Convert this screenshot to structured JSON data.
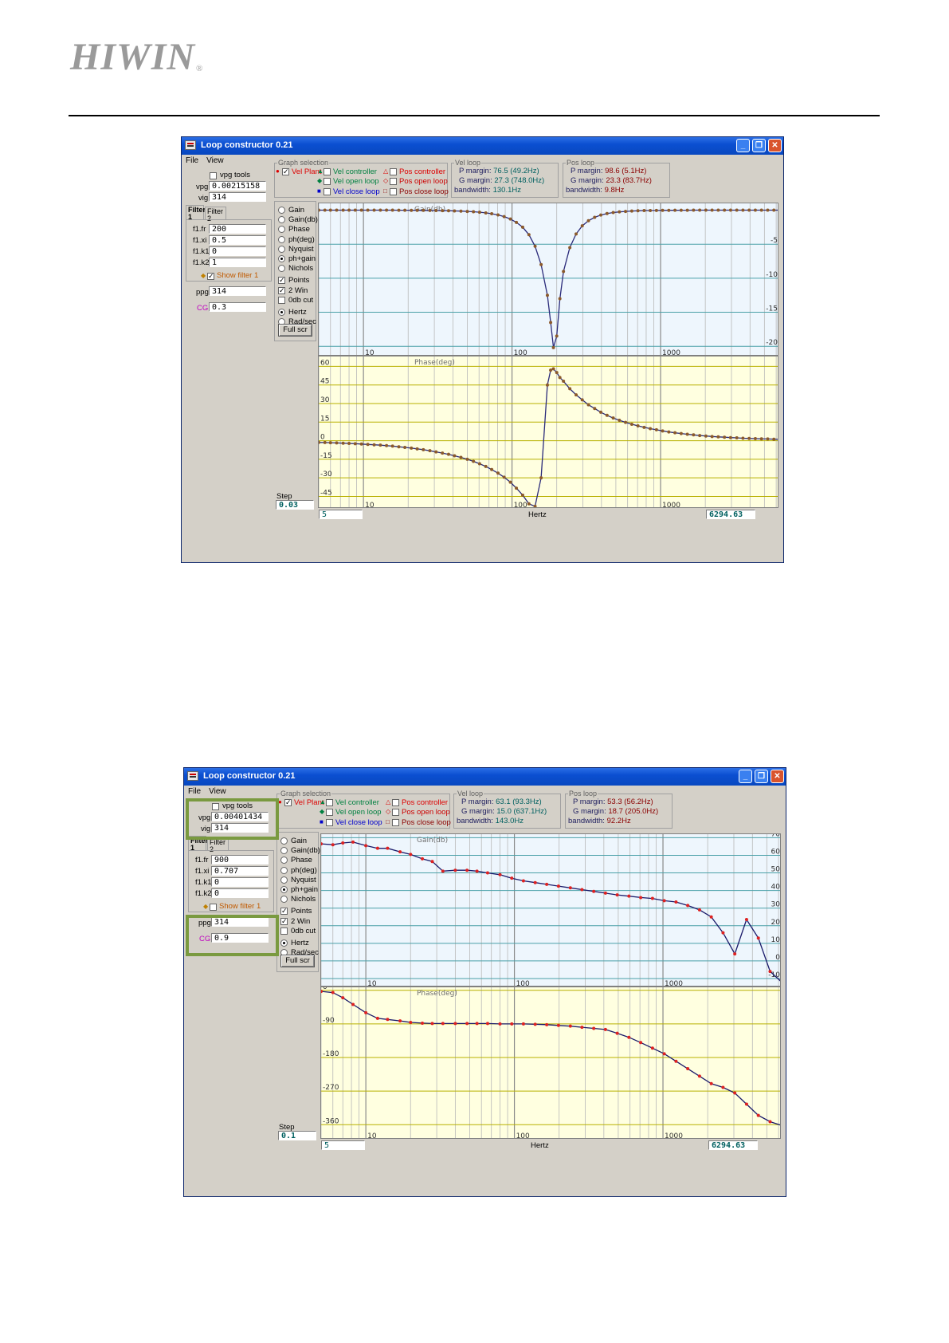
{
  "logo": {
    "text": "HIWIN",
    "reg": "®"
  },
  "windows": [
    {
      "title": "Loop constructor 0.21",
      "menu": [
        "File",
        "View"
      ],
      "vpg_tools_label": "vpg tools",
      "vpg_label": "vpg",
      "vpg_value": "0.00215158",
      "vig_label": "vig",
      "vig_value": "314",
      "tabs": [
        {
          "line1": "Filter",
          "line2": "1"
        },
        {
          "line1": "Filter",
          "line2": "2"
        }
      ],
      "filter": [
        {
          "label": "f1.fr",
          "value": "200"
        },
        {
          "label": "f1.xi",
          "value": "0.5"
        },
        {
          "label": "f1.k1",
          "value": "0"
        },
        {
          "label": "f1.k2",
          "value": "1"
        }
      ],
      "show_filter_label": "Show filter 1",
      "show_filter_checked": true,
      "ppg_label": "ppg",
      "ppg_value": "314",
      "cg_label": "CG",
      "cg_value": "0.3",
      "graph_selection_title": "Graph selection",
      "graph_items": [
        {
          "label": "Vel Plant",
          "checked": true,
          "color": "#dd0000",
          "marker": "●"
        },
        {
          "label": "Vel controller",
          "checked": false,
          "color": "#008040",
          "marker": "▲"
        },
        {
          "label": "Vel open loop",
          "checked": false,
          "color": "#008040",
          "marker": "◆"
        },
        {
          "label": "Vel close loop",
          "checked": false,
          "color": "#0000cc",
          "marker": "■"
        },
        {
          "label": "Pos controller",
          "checked": false,
          "color": "#dd0000",
          "marker": "△"
        },
        {
          "label": "Pos open loop",
          "checked": false,
          "color": "#cc0000",
          "marker": "◇"
        },
        {
          "label": "Pos close loop",
          "checked": false,
          "color": "#8b0000",
          "marker": "□"
        }
      ],
      "vel_loop": {
        "title": "Vel loop",
        "p_margin": "76.5 (49.2Hz)",
        "g_margin": "27.3 (748.0Hz)",
        "bandwidth": "130.1Hz"
      },
      "pos_loop": {
        "title": "Pos loop",
        "p_margin": "98.6 (5.1Hz)",
        "g_margin": "23.3 (83.7Hz)",
        "bandwidth": "9.8Hz"
      },
      "margin_labels": {
        "p": "P margin:",
        "g": "G margin:",
        "bw": "bandwidth:"
      },
      "options": [
        {
          "label": "Gain",
          "type": "radio",
          "on": false
        },
        {
          "label": "Gain(db)",
          "type": "radio",
          "on": false
        },
        {
          "label": "Phase",
          "type": "radio",
          "on": false
        },
        {
          "label": "ph(deg)",
          "type": "radio",
          "on": false
        },
        {
          "label": "Nyquist",
          "type": "radio",
          "on": false
        },
        {
          "label": "ph+gain",
          "type": "radio",
          "on": true
        },
        {
          "label": "Nichols",
          "type": "radio",
          "on": false
        },
        {
          "label": "Points",
          "type": "check",
          "on": true
        },
        {
          "label": "2 Win",
          "type": "check",
          "on": true
        },
        {
          "label": "0db cut",
          "type": "check",
          "on": false
        },
        {
          "label": "Hertz",
          "type": "radio",
          "on": true
        },
        {
          "label": "Rad/sec",
          "type": "radio",
          "on": false
        }
      ],
      "full_scr": "Full scr",
      "step_label": "Step",
      "step_value": "0.03",
      "xmin_value": "5",
      "xaxis_label": "Hertz",
      "xmax_value": "6294.63",
      "highlight": false,
      "chart_data": [
        {
          "type": "line",
          "title": "Gain(db)",
          "x_scale": "log",
          "xlim": [
            5,
            6294.63
          ],
          "x_ticks": [
            10,
            100,
            1000
          ],
          "ylim": [
            -21.5,
            1
          ],
          "y_ticks": [
            -5,
            -10,
            -15,
            -20
          ],
          "y_tick_labels": [
            "-5",
            "-10",
            "-15",
            "-20"
          ],
          "y_ticks_side": "right",
          "line_color": "#2a2a7a",
          "point_color": "#8b5a2b",
          "background": "#eef6fd",
          "grid": true,
          "x": [
            5,
            5.5,
            6,
            6.6,
            7.3,
            8,
            8.8,
            9.7,
            10.7,
            11.8,
            13,
            14.3,
            15.7,
            17.3,
            19,
            21,
            23,
            25.3,
            28,
            30.8,
            34,
            37.4,
            41,
            45.3,
            50,
            55,
            60.5,
            66.6,
            73,
            80.5,
            88.5,
            97.5,
            107,
            118,
            130,
            143,
            157,
            173,
            182,
            190,
            200,
            210,
            222,
            245,
            270,
            297,
            327,
            360,
            396,
            436,
            480,
            528,
            581,
            640,
            704,
            775,
            852,
            938,
            1032,
            1136,
            1250,
            1376,
            1514,
            1666,
            1834,
            2018,
            2221,
            2444,
            2690,
            2960,
            3258,
            3585,
            3946,
            4342,
            4779,
            5259,
            5788,
            6294
          ],
          "values": [
            0,
            0,
            0,
            0,
            0,
            0,
            0,
            0,
            0,
            0,
            0,
            0,
            0,
            -0.01,
            -0.01,
            -0.02,
            -0.02,
            -0.03,
            -0.04,
            -0.05,
            -0.07,
            -0.08,
            -0.11,
            -0.14,
            -0.18,
            -0.23,
            -0.3,
            -0.4,
            -0.52,
            -0.7,
            -0.95,
            -1.3,
            -1.8,
            -2.5,
            -3.6,
            -5.3,
            -8.0,
            -12.5,
            -16.5,
            -20.2,
            -18.5,
            -13,
            -9,
            -5.5,
            -3.5,
            -2.3,
            -1.55,
            -1.05,
            -0.72,
            -0.5,
            -0.35,
            -0.25,
            -0.18,
            -0.13,
            -0.09,
            -0.06,
            -0.05,
            -0.04,
            -0.03,
            -0.02,
            -0.015,
            -0.01,
            -0.01,
            0,
            0,
            0,
            0,
            0,
            0,
            0,
            0,
            0,
            0,
            0,
            0,
            0,
            0,
            0
          ]
        },
        {
          "type": "line",
          "title": "Phase(deg)",
          "x_scale": "log",
          "xlim": [
            5,
            6294.63
          ],
          "x_ticks": [
            10,
            100,
            1000
          ],
          "ylim": [
            -55,
            68
          ],
          "y_ticks": [
            60,
            45,
            30,
            15,
            0,
            -15,
            -30,
            -45
          ],
          "y_tick_labels": [
            "60",
            "45",
            "30",
            "15",
            "0",
            "-15",
            "-30",
            "-45"
          ],
          "y_ticks_side": "left",
          "line_color": "#2a2a7a",
          "point_color": "#8b5a2b",
          "background": "#ffffe0",
          "grid": true,
          "x": [
            5,
            5.5,
            6,
            6.6,
            7.3,
            8,
            8.8,
            9.7,
            10.7,
            11.8,
            13,
            14.3,
            15.7,
            17.3,
            19,
            21,
            23,
            25.3,
            28,
            30.8,
            34,
            37.4,
            41,
            45.3,
            50,
            55,
            60.5,
            66.6,
            73,
            80.5,
            88.5,
            97.5,
            107,
            118,
            130,
            143,
            157,
            173,
            182,
            190,
            200,
            210,
            222,
            245,
            270,
            297,
            327,
            360,
            396,
            436,
            480,
            528,
            581,
            640,
            704,
            775,
            852,
            938,
            1032,
            1136,
            1250,
            1376,
            1514,
            1666,
            1834,
            2018,
            2221,
            2444,
            2690,
            2960,
            3258,
            3585,
            3946,
            4342,
            4779,
            5259,
            5788,
            6294
          ],
          "values": [
            -1.4,
            -1.5,
            -1.6,
            -1.8,
            -2.0,
            -2.2,
            -2.4,
            -2.7,
            -3.0,
            -3.3,
            -3.6,
            -4.0,
            -4.4,
            -4.9,
            -5.4,
            -6.0,
            -6.6,
            -7.3,
            -8.1,
            -9.0,
            -10.0,
            -11.0,
            -12.2,
            -13.5,
            -15.0,
            -16.7,
            -18.6,
            -20.8,
            -23.3,
            -26.2,
            -29.5,
            -33.5,
            -38.3,
            -44.0,
            -51.0,
            -53.0,
            -30.0,
            45.0,
            57.0,
            58.0,
            55.0,
            51.0,
            48.0,
            42.0,
            37.0,
            33.0,
            29.0,
            26.0,
            23.0,
            20.5,
            18.3,
            16.5,
            14.8,
            13.3,
            12.0,
            10.8,
            9.7,
            8.8,
            7.9,
            7.1,
            6.4,
            5.8,
            5.2,
            4.7,
            4.2,
            3.8,
            3.4,
            3.1,
            2.8,
            2.5,
            2.3,
            2.0,
            1.8,
            1.7,
            1.5,
            1.4,
            1.2,
            1.1
          ]
        }
      ]
    },
    {
      "title": "Loop constructor 0.21",
      "menu": [
        "File",
        "View"
      ],
      "vpg_tools_label": "vpg tools",
      "vpg_label": "vpg",
      "vpg_value": "0.00401434",
      "vig_label": "vig",
      "vig_value": "314",
      "tabs": [
        {
          "line1": "Filter",
          "line2": "1"
        },
        {
          "line1": "Filter",
          "line2": "2"
        }
      ],
      "filter": [
        {
          "label": "f1.fr",
          "value": "900"
        },
        {
          "label": "f1.xi",
          "value": "0.707"
        },
        {
          "label": "f1.k1",
          "value": "0"
        },
        {
          "label": "f1.k2",
          "value": "0"
        }
      ],
      "show_filter_label": "Show filter 1",
      "show_filter_checked": false,
      "ppg_label": "ppg",
      "ppg_value": "314",
      "cg_label": "CG",
      "cg_value": "0.9",
      "graph_selection_title": "Graph selection",
      "graph_items": [
        {
          "label": "Vel Plant",
          "checked": true,
          "color": "#dd0000",
          "marker": "●"
        },
        {
          "label": "Vel controller",
          "checked": false,
          "color": "#008040",
          "marker": "▲"
        },
        {
          "label": "Vel open loop",
          "checked": false,
          "color": "#008040",
          "marker": "◆"
        },
        {
          "label": "Vel close loop",
          "checked": false,
          "color": "#0000cc",
          "marker": "■"
        },
        {
          "label": "Pos controller",
          "checked": false,
          "color": "#dd0000",
          "marker": "△"
        },
        {
          "label": "Pos open loop",
          "checked": false,
          "color": "#cc0000",
          "marker": "◇"
        },
        {
          "label": "Pos close loop",
          "checked": false,
          "color": "#8b0000",
          "marker": "□"
        }
      ],
      "vel_loop": {
        "title": "Vel loop",
        "p_margin": "63.1 (93.3Hz)",
        "g_margin": "15.0 (637.1Hz)",
        "bandwidth": "143.0Hz"
      },
      "pos_loop": {
        "title": "Pos loop",
        "p_margin": "53.3 (56.2Hz)",
        "g_margin": "18.7 (205.0Hz)",
        "bandwidth": "92.2Hz"
      },
      "margin_labels": {
        "p": "P margin:",
        "g": "G margin:",
        "bw": "bandwidth:"
      },
      "options": [
        {
          "label": "Gain",
          "type": "radio",
          "on": false
        },
        {
          "label": "Gain(db)",
          "type": "radio",
          "on": false
        },
        {
          "label": "Phase",
          "type": "radio",
          "on": false
        },
        {
          "label": "ph(deg)",
          "type": "radio",
          "on": false
        },
        {
          "label": "Nyquist",
          "type": "radio",
          "on": false
        },
        {
          "label": "ph+gain",
          "type": "radio",
          "on": true
        },
        {
          "label": "Nichols",
          "type": "radio",
          "on": false
        },
        {
          "label": "Points",
          "type": "check",
          "on": true
        },
        {
          "label": "2 Win",
          "type": "check",
          "on": true
        },
        {
          "label": "0db cut",
          "type": "check",
          "on": false
        },
        {
          "label": "Hertz",
          "type": "radio",
          "on": true
        },
        {
          "label": "Rad/sec",
          "type": "radio",
          "on": false
        }
      ],
      "full_scr": "Full scr",
      "step_label": "Step",
      "step_value": "0.1",
      "xmin_value": "5",
      "xaxis_label": "Hertz",
      "xmax_value": "6294.63",
      "highlight": true,
      "chart_data": [
        {
          "type": "line",
          "title": "Gain(db)",
          "x_scale": "log",
          "xlim": [
            5,
            6294.63
          ],
          "x_ticks": [
            10,
            100,
            1000
          ],
          "ylim": [
            -15,
            72
          ],
          "y_ticks": [
            70,
            60,
            50,
            40,
            30,
            20,
            10,
            0,
            -10
          ],
          "y_tick_labels": [
            "70",
            "60",
            "50",
            "40",
            "30",
            "20",
            "10",
            "0",
            "-10"
          ],
          "y_ticks_side": "right",
          "line_color": "#1a1a6a",
          "point_color": "#dd2222",
          "background": "#eef6fd",
          "grid": true,
          "x": [
            5,
            6,
            7,
            8.2,
            10,
            12,
            14,
            17,
            20,
            24,
            28,
            33,
            40,
            48,
            56,
            66,
            80,
            96,
            115,
            138,
            165,
            198,
            238,
            285,
            342,
            410,
            492,
            590,
            708,
            850,
            1020,
            1224,
            1468,
            1762,
            2114,
            2537,
            3044,
            3653,
            4384,
            5260,
            6294
          ],
          "values": [
            66.5,
            66,
            67,
            67.5,
            65.5,
            64,
            64,
            62,
            60.5,
            58,
            56.5,
            51,
            51.5,
            51.5,
            51,
            50,
            49,
            47,
            45.5,
            44.5,
            43.5,
            42.5,
            41.5,
            40.5,
            39.5,
            38.5,
            37.5,
            36.8,
            36,
            35.5,
            34.2,
            33.5,
            31.5,
            29,
            25,
            16,
            4,
            23.5,
            13,
            -6,
            -12
          ]
        },
        {
          "type": "line",
          "title": "Phase(deg)",
          "x_scale": "log",
          "xlim": [
            5,
            6294.63
          ],
          "x_ticks": [
            10,
            100,
            1000
          ],
          "ylim": [
            -400,
            8
          ],
          "y_ticks": [
            0,
            -90,
            -180,
            -270,
            -360
          ],
          "y_tick_labels": [
            "0",
            "-90",
            "-180",
            "-270",
            "-360"
          ],
          "y_ticks_side": "left",
          "line_color": "#1a1a6a",
          "point_color": "#dd2222",
          "background": "#ffffe0",
          "grid": true,
          "x": [
            5,
            6,
            7,
            8.2,
            10,
            12,
            14,
            17,
            20,
            24,
            28,
            33,
            40,
            48,
            56,
            66,
            80,
            96,
            115,
            138,
            165,
            198,
            238,
            285,
            342,
            410,
            492,
            590,
            708,
            850,
            1020,
            1224,
            1468,
            1762,
            2114,
            2537,
            3044,
            3653,
            4384,
            5260,
            6294
          ],
          "values": [
            -3,
            -6,
            -20,
            -38,
            -60,
            -75,
            -78,
            -82,
            -86,
            -88,
            -89,
            -89,
            -89,
            -89,
            -89,
            -89,
            -90,
            -90,
            -90,
            -91,
            -92,
            -94,
            -96,
            -99,
            -102,
            -105,
            -115,
            -126,
            -140,
            -155,
            -170,
            -190,
            -210,
            -230,
            -250,
            -260,
            -275,
            -305,
            -335,
            -352,
            -362
          ]
        }
      ]
    }
  ]
}
